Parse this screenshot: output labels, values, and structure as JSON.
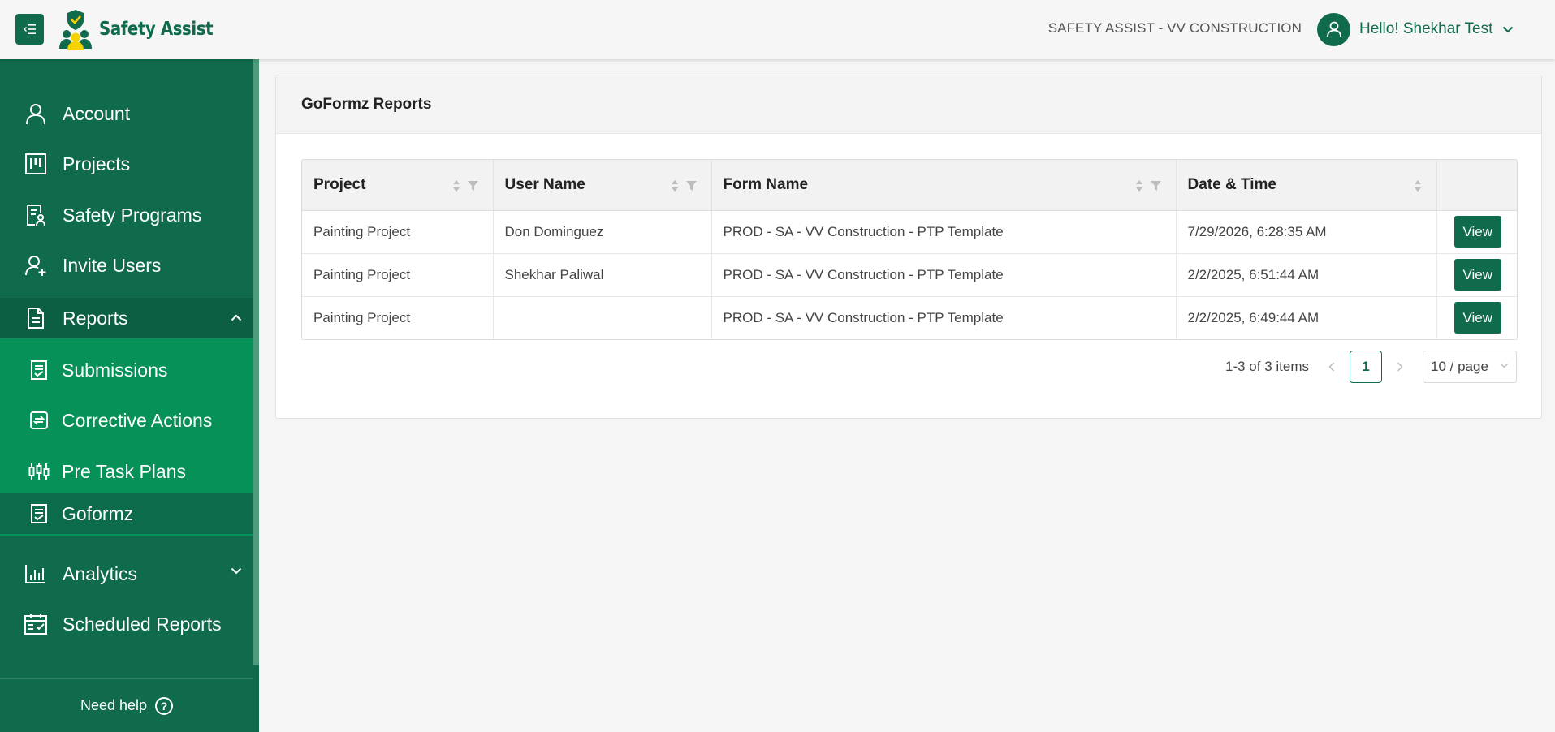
{
  "header": {
    "app_name": "Safety Assist",
    "org_name": "SAFETY ASSIST - VV CONSTRUCTION",
    "greeting": "Hello! Shekhar Test"
  },
  "sidebar": {
    "items": [
      {
        "label": "Account",
        "icon": "user-icon"
      },
      {
        "label": "Projects",
        "icon": "kanban-icon"
      },
      {
        "label": "Safety Programs",
        "icon": "document-user-icon"
      },
      {
        "label": "Invite Users",
        "icon": "user-plus-icon"
      },
      {
        "label": "Reports",
        "icon": "file-icon",
        "expanded": true
      },
      {
        "label": "Submissions",
        "icon": "clipboard-check-icon"
      },
      {
        "label": "Corrective Actions",
        "icon": "refresh-square-icon"
      },
      {
        "label": "Pre Task Plans",
        "icon": "candlestick-icon"
      },
      {
        "label": "Goformz",
        "icon": "clipboard-check-icon",
        "active": true
      },
      {
        "label": "Analytics",
        "icon": "bar-chart-icon"
      },
      {
        "label": "Scheduled Reports",
        "icon": "calendar-check-icon"
      }
    ],
    "help_label": "Need help"
  },
  "card": {
    "title": "GoFormz Reports"
  },
  "table": {
    "columns": [
      "Project",
      "User Name",
      "Form Name",
      "Date & Time",
      ""
    ],
    "rows": [
      {
        "project": "Painting Project",
        "user": "Don Dominguez",
        "form": "PROD - SA - VV Construction - PTP Template",
        "datetime": "7/29/2026, 6:28:35 AM",
        "action": "View"
      },
      {
        "project": "Painting Project",
        "user": "Shekhar Paliwal",
        "form": "PROD - SA - VV Construction - PTP Template",
        "datetime": "2/2/2025, 6:51:44 AM",
        "action": "View"
      },
      {
        "project": "Painting Project",
        "user": "",
        "form": "PROD - SA - VV Construction - PTP Template",
        "datetime": "2/2/2025, 6:49:44 AM",
        "action": "View"
      }
    ]
  },
  "pager": {
    "info": "1-3 of 3 items",
    "current_page": "1",
    "page_size": "10 / page"
  },
  "colors": {
    "brand": "#0f6b4b",
    "submenu": "#069158"
  }
}
